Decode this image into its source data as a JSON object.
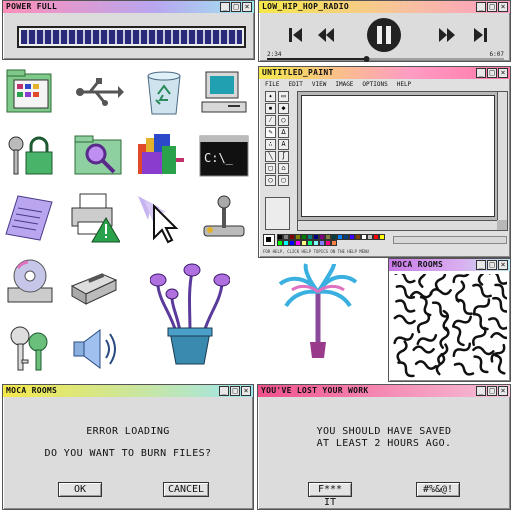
{
  "power_window": {
    "title": "POWER FULL",
    "progress": 1.0,
    "controls": [
      "_",
      "□",
      "×"
    ]
  },
  "radio_window": {
    "title": "LOW_HIP_HOP_RADIO",
    "elapsed": "2:34",
    "duration": "6:07",
    "progress": 0.42,
    "controls": [
      "_",
      "□",
      "×"
    ],
    "player_icons": [
      "skip-back-icon",
      "rewind-icon",
      "pause-icon",
      "fast-forward-icon",
      "skip-forward-icon"
    ]
  },
  "paint_window": {
    "title": "UNTITLED_PAINT",
    "menu": [
      "FILE",
      "EDIT",
      "VIEW",
      "IMAGE",
      "OPTIONS",
      "HELP"
    ],
    "status": "FOR HELP, CLICK HELP TOPICS ON THE HELP MENU",
    "tool_a_label": "A",
    "palette": [
      "#000000",
      "#808080",
      "#800000",
      "#808000",
      "#008000",
      "#008080",
      "#000080",
      "#800080",
      "#808040",
      "#004040",
      "#0080ff",
      "#004080",
      "#4000ff",
      "#804000",
      "#ffffff",
      "#c0c0c0",
      "#ff0000",
      "#ffff00",
      "#00ff00",
      "#00ffff",
      "#0000ff",
      "#ff00ff",
      "#ffff80",
      "#00ff80",
      "#80ffff",
      "#8080ff",
      "#ff0080",
      "#ff8040"
    ]
  },
  "moca_small_window": {
    "title": "MOCA ROOMS"
  },
  "moca_dialog": {
    "title": "MOCA ROOMS",
    "line1": "ERROR LOADING",
    "line2": "DO YOU WANT TO BURN FILES?",
    "ok_label": "OK",
    "cancel_label": "CANCEL"
  },
  "lost_dialog": {
    "title": "YOU'VE LOST YOUR WORK",
    "line1": "YOU SHOULD HAVE SAVED",
    "line2": "AT LEAST 2 HOURS AGO.",
    "button1_label": "F*** IT",
    "button2_label": "#%&@!"
  },
  "desktop_icons": [
    "control-panel-folder-icon",
    "usb-icon",
    "recycle-bin-icon",
    "my-computer-icon",
    "key-lock-icon",
    "folder-search-icon",
    "programs-icon",
    "command-prompt-icon",
    "notepad-icon",
    "printer-warning-icon",
    "cursor-trail-icon",
    "joystick-icon",
    "cd-drive-icon",
    "disk-drive-icon",
    "venus-flytrap-plant-icon",
    "palm-plant-icon",
    "keys-icon",
    "speaker-icon"
  ],
  "colors": {
    "titlebar_pink": "#ff77a8",
    "titlebar_cyan": "#9ee6f0",
    "titlebar_yellow": "#f5e84a",
    "titlebar_purple": "#c97ae8",
    "titlebar_magenta": "#f0508c",
    "progress_fill": "#2a2a7a"
  }
}
